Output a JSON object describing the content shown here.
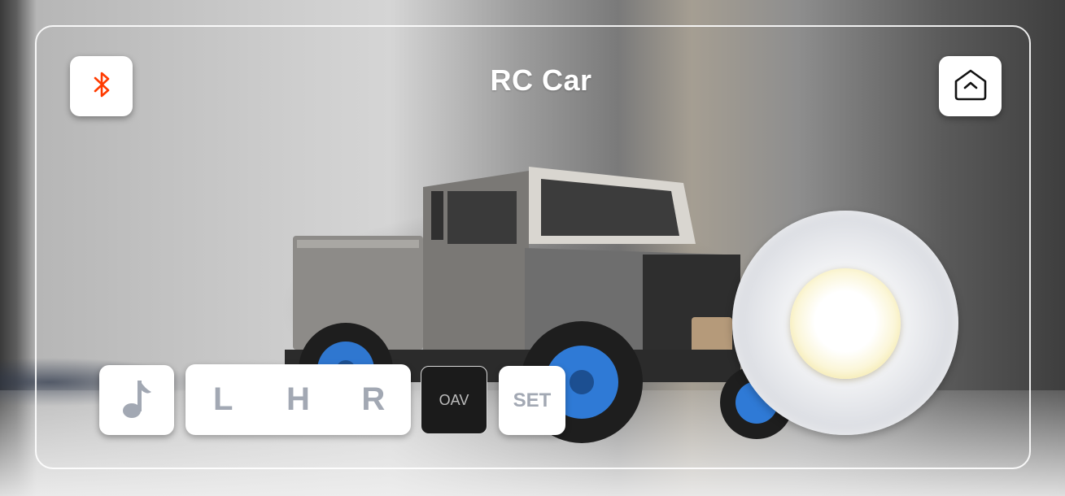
{
  "header": {
    "title": "RC Car",
    "bluetooth_icon": "bluetooth-icon",
    "home_icon": "home-icon"
  },
  "controls": {
    "music_icon": "music-note-icon",
    "lights": [
      "L",
      "H",
      "R"
    ],
    "oav_label": "OAV",
    "set_label": "SET"
  },
  "joystick": {
    "name": "joystick"
  },
  "colors": {
    "bluetooth_accent": "#ff3b00",
    "button_text": "#a2a8b3",
    "knob": "#f2e49a"
  }
}
